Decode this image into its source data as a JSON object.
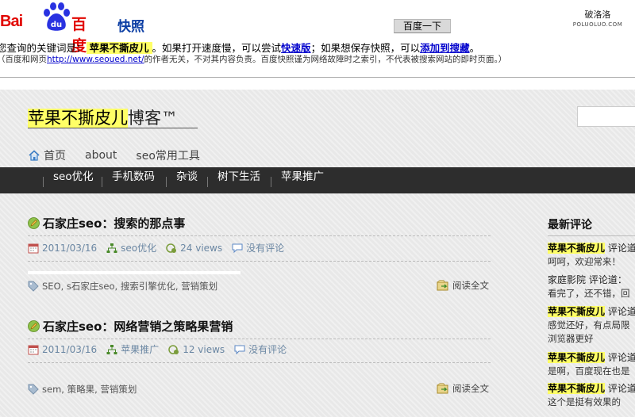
{
  "snapshot": {
    "logo_bai": "Bai",
    "logo_du": "百度",
    "logo_kuaizhao": "快照",
    "search_button": "百度一下",
    "watermark_zh": "破洛洛",
    "watermark_en": "POLUOLUO.COM",
    "line1_prefix": "您查询的关键词是：",
    "line1_keyword": "苹果不撕皮儿",
    "line1_mid1": "。如果打开速度慢，可以尝试",
    "line1_fast_link": "快速版",
    "line1_mid2": "；如果想保存快照，可以",
    "line1_save_link": "添加到搜藏",
    "line1_end": "。",
    "line2_prefix": "（百度和网页",
    "line2_url": "http://www.seoued.net/",
    "line2_suffix": "的作者无关，不对其内容负责。百度快照谨为网络故障时之索引，不代表被搜索网站的即时页面。）"
  },
  "blog": {
    "title_highlight": "苹果不撕皮儿",
    "title_rest": "博客™",
    "top_nav": [
      "首页",
      "about",
      "seo常用工具"
    ],
    "categories": [
      "seo优化",
      "手机数码",
      "杂谈",
      "树下生活",
      "苹果推广"
    ],
    "posts": [
      {
        "title": "石家庄seo：搜索的那点事",
        "date": "2011/03/16",
        "category": "seo优化",
        "views": "24 views",
        "comments": "没有评论",
        "tags": "SEO, s石家庄seo, 搜索引擎优化, 营销策划",
        "read_more": "阅读全文"
      },
      {
        "title": "石家庄seo：网络营销之策略果营销",
        "date": "2011/03/16",
        "category": "苹果推广",
        "views": "12 views",
        "comments": "没有评论",
        "tags": "sem, 策略果, 营销策划",
        "read_more": "阅读全文"
      }
    ]
  },
  "sidebar": {
    "title": "最新评论",
    "comments": [
      {
        "author": "苹果不撕皮儿",
        "author_highlight": true,
        "said": "评论道：",
        "text": "呵呵，欢迎常来！"
      },
      {
        "author": "家庭影院",
        "author_highlight": false,
        "said": "评论道：",
        "text": "看完了，还不错，回"
      },
      {
        "author": "苹果不撕皮儿",
        "author_highlight": true,
        "said": "评论道：",
        "text": "感觉还好，有点局限"
      },
      {
        "author": "",
        "author_highlight": false,
        "said": "",
        "text": "浏览器更好"
      },
      {
        "author": "苹果不撕皮儿",
        "author_highlight": true,
        "said": "评论道：",
        "text": "是啊，百度现在也是"
      },
      {
        "author": "苹果不撕皮儿",
        "author_highlight": true,
        "said": "评论道：",
        "text": "这个是挺有效果的"
      }
    ]
  },
  "colors": {
    "baidu_red": "#e10601",
    "baidu_blue": "#0b3ea4",
    "keyword_highlight": "#ffff66",
    "category_bar": "#2d2d2d",
    "meta_text": "#6b87a3"
  },
  "icons": [
    "baidu-paw-icon",
    "home-icon",
    "pen-icon",
    "calendar-icon",
    "category-icon",
    "views-icon",
    "comment-icon",
    "tag-icon",
    "read-more-icon"
  ]
}
